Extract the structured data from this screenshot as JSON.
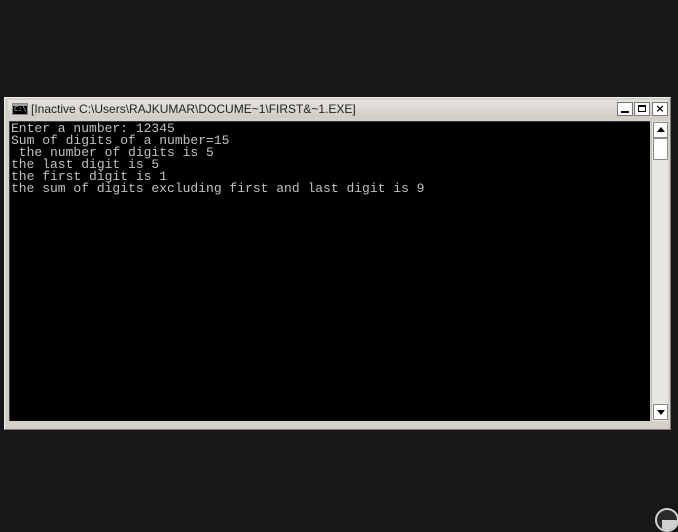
{
  "window": {
    "title": "[Inactive C:\\Users\\RAJKUMAR\\DOCUME~1\\FIRST&~1.EXE]",
    "icon": "console-app-icon",
    "icon_text": "C:\\",
    "controls": {
      "minimize": "minimize-icon",
      "maximize": "maximize-icon",
      "close": "×"
    }
  },
  "console": {
    "lines": [
      "Enter a number: 12345",
      "Sum of digits of a number=15",
      " the number of digits is 5",
      "the last digit is 5",
      "the first digit is 1",
      "the sum of digits excluding first and last digit is 9"
    ],
    "text_color": "#c0c0c0",
    "background_color": "#000000"
  },
  "colors": {
    "desktop": "#171717",
    "chrome": "#d4d0c8"
  }
}
